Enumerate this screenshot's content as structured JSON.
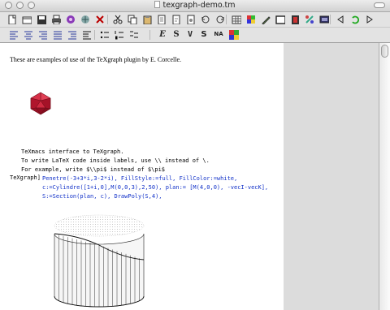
{
  "window": {
    "title": "texgraph-demo.tm"
  },
  "toolbar_main": [
    "new-doc-icon",
    "open-icon",
    "save-icon",
    "print-icon",
    "preview-icon",
    "export-icon",
    "close-x-icon",
    "cut-icon",
    "copy-icon",
    "paste-icon",
    "page-icon",
    "page2-icon",
    "page3-icon",
    "undo-icon",
    "redo-icon",
    "table-icon",
    "color-icon",
    "pen-icon",
    "frame-icon",
    "movie-icon",
    "links-icon",
    "screen-icon",
    "nav-left-icon",
    "refresh-icon",
    "nav-right-icon"
  ],
  "toolbar_format": {
    "align_icons": [
      "align-left-icon",
      "align-center-icon",
      "align-right-icon",
      "justify-icon",
      "indent-icon",
      "outdent-icon",
      "bullets-icon",
      "numbered-list-icon",
      "description-list-icon"
    ],
    "emphasis_label": "E",
    "bold_label": "S",
    "verbatim_label": "V",
    "sans_label": "S",
    "na_label": "NA"
  },
  "document": {
    "intro": "These are examples of use of the TeXgraph plugin by E. Corcelle.",
    "interface_output": [
      "TeXmacs interface to TeXgraph.",
      "To write LaTeX code inside labels, use \\\\ instead of \\.",
      "For example, write $\\\\pi$ instead of $\\pi$"
    ],
    "prompt": "TeXgraph]",
    "input_lines": [
      "Penetre(-3+3*i,3-2*i), FillStyle:=full, FillColor:=white,",
      "c:=Cylindre([1+i,0],M(0,0,3),2,50), plan:= [M(4,0,0), -vecI-vecK],",
      "S:=Section(plan, c), DrawPoly(S,4),"
    ]
  },
  "colors": {
    "icosahedron": "#c41a33",
    "input_text": "#1030c8"
  }
}
